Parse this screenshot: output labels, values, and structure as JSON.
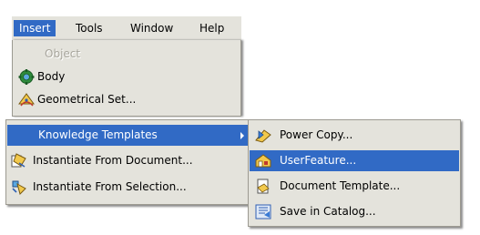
{
  "menubar": {
    "items": [
      {
        "label": "Insert"
      },
      {
        "label": "Tools"
      },
      {
        "label": "Window"
      },
      {
        "label": "Help"
      }
    ]
  },
  "insert_menu": {
    "items": [
      {
        "label": "Object",
        "disabled": true,
        "icon": "none"
      },
      {
        "label": "Body",
        "icon": "body-gear-icon"
      },
      {
        "label": "Geometrical Set...",
        "icon": "geometrical-set-icon"
      }
    ]
  },
  "insert_menu_lower": {
    "items": [
      {
        "label": "Knowledge Templates",
        "highlighted": true,
        "has_submenu": true
      },
      {
        "label": "Instantiate From Document...",
        "icon": "instantiate-document-icon"
      },
      {
        "label": "Instantiate From Selection...",
        "icon": "instantiate-selection-icon"
      }
    ]
  },
  "knowledge_templates_submenu": {
    "items": [
      {
        "label": "Power Copy...",
        "icon": "power-copy-icon"
      },
      {
        "label": "UserFeature...",
        "icon": "user-feature-icon",
        "highlighted": true
      },
      {
        "label": "Document Template...",
        "icon": "document-template-icon"
      },
      {
        "label": "Save in Catalog...",
        "icon": "save-in-catalog-icon"
      }
    ]
  },
  "colors": {
    "menu_background": "#e4e3dc",
    "highlight": "#316ac5",
    "disabled_text": "#a7a59c"
  }
}
